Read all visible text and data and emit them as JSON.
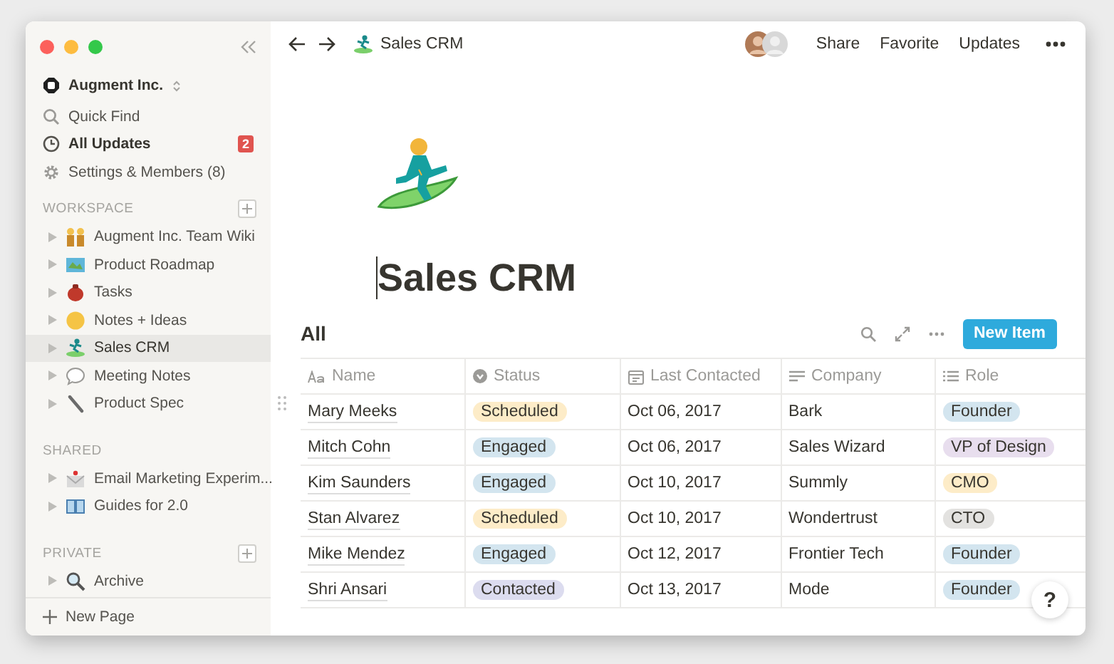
{
  "sidebar": {
    "workspace": "Augment Inc.",
    "nav": [
      {
        "label": "Quick Find",
        "kind": "search"
      },
      {
        "label": "All Updates",
        "kind": "clock",
        "badge": "2"
      },
      {
        "label": "Settings & Members (8)",
        "kind": "gear"
      }
    ],
    "sections": [
      {
        "title": "WORKSPACE",
        "add_button": true,
        "items": [
          {
            "label": "Augment Inc. Team Wiki",
            "selected": false
          },
          {
            "label": "Product Roadmap",
            "selected": false
          },
          {
            "label": "Tasks",
            "selected": false
          },
          {
            "label": "Notes + Ideas",
            "selected": false
          },
          {
            "label": "Sales CRM",
            "selected": true
          },
          {
            "label": "Meeting Notes",
            "selected": false
          },
          {
            "label": "Product Spec",
            "selected": false
          }
        ]
      },
      {
        "title": "SHARED",
        "add_button": false,
        "items": [
          {
            "label": "Email Marketing Experim...",
            "selected": false
          },
          {
            "label": "Guides for 2.0",
            "selected": false
          }
        ]
      },
      {
        "title": "PRIVATE",
        "add_button": true,
        "items": [
          {
            "label": "Archive",
            "selected": false
          }
        ]
      }
    ],
    "new_page": "New Page"
  },
  "topbar": {
    "breadcrumb": "Sales CRM",
    "actions": [
      "Share",
      "Favorite",
      "Updates"
    ]
  },
  "page": {
    "title": "Sales CRM"
  },
  "view": {
    "title": "All",
    "button": "New Item"
  },
  "table": {
    "columns": [
      {
        "label": "Name",
        "kind": "title"
      },
      {
        "label": "Status",
        "kind": "select"
      },
      {
        "label": "Last Contacted",
        "kind": "date"
      },
      {
        "label": "Company",
        "kind": "text"
      },
      {
        "label": "Role",
        "kind": "multi_select"
      }
    ],
    "rows": [
      {
        "name": "Mary Meeks",
        "status": {
          "label": "Scheduled",
          "color": "#fdecc8"
        },
        "date": "Oct 06, 2017",
        "company": "Bark",
        "role": {
          "label": "Founder",
          "color": "#d3e5ef"
        }
      },
      {
        "name": "Mitch Cohn",
        "status": {
          "label": "Engaged",
          "color": "#d3e5ef"
        },
        "date": "Oct 06, 2017",
        "company": "Sales Wizard",
        "role": {
          "label": "VP of Design",
          "color": "#e8deee"
        }
      },
      {
        "name": "Kim Saunders",
        "status": {
          "label": "Engaged",
          "color": "#d3e5ef"
        },
        "date": "Oct 10, 2017",
        "company": "Summly",
        "role": {
          "label": "CMO",
          "color": "#fdecc8"
        }
      },
      {
        "name": "Stan Alvarez",
        "status": {
          "label": "Scheduled",
          "color": "#fdecc8"
        },
        "date": "Oct 10, 2017",
        "company": "Wondertrust",
        "role": {
          "label": "CTO",
          "color": "#e3e2e0"
        }
      },
      {
        "name": "Mike Mendez",
        "status": {
          "label": "Engaged",
          "color": "#d3e5ef"
        },
        "date": "Oct 12, 2017",
        "company": "Frontier Tech",
        "role": {
          "label": "Founder",
          "color": "#d3e5ef"
        }
      },
      {
        "name": "Shri Ansari",
        "status": {
          "label": "Contacted",
          "color": "#dcdcef"
        },
        "date": "Oct 13, 2017",
        "company": "Mode",
        "role": {
          "label": "Founder",
          "color": "#d3e5ef"
        }
      }
    ]
  },
  "help": "?"
}
